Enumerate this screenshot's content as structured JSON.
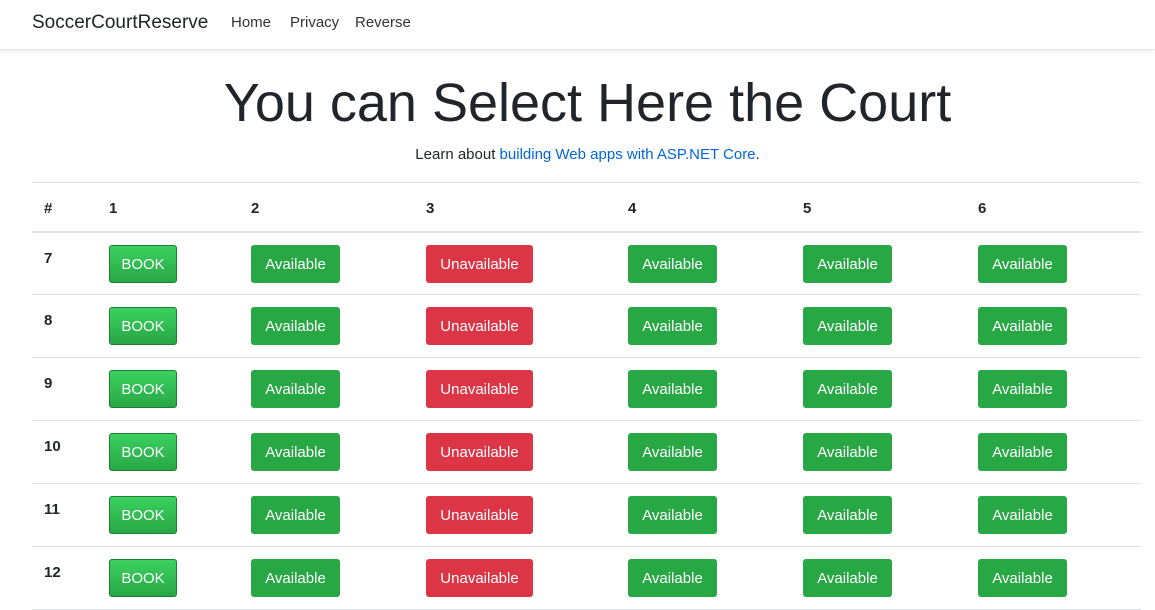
{
  "navbar": {
    "brand": "SoccerCourtReserve",
    "links": [
      "Home",
      "Privacy",
      "Reverse"
    ]
  },
  "hero": {
    "title": "You can Select Here the Court",
    "sub_prefix": "Learn about ",
    "sub_link": "building Web apps with ASP.NET Core",
    "sub_suffix": "."
  },
  "table": {
    "headers": [
      "#",
      "1",
      "2",
      "3",
      "4",
      "5",
      "6"
    ],
    "rows": [
      {
        "num": "7",
        "cells": [
          "BOOK",
          "Available",
          "Unavailable",
          "Available",
          "Available",
          "Available"
        ]
      },
      {
        "num": "8",
        "cells": [
          "BOOK",
          "Available",
          "Unavailable",
          "Available",
          "Available",
          "Available"
        ]
      },
      {
        "num": "9",
        "cells": [
          "BOOK",
          "Available",
          "Unavailable",
          "Available",
          "Available",
          "Available"
        ]
      },
      {
        "num": "10",
        "cells": [
          "BOOK",
          "Available",
          "Unavailable",
          "Available",
          "Available",
          "Available"
        ]
      },
      {
        "num": "11",
        "cells": [
          "BOOK",
          "Available",
          "Unavailable",
          "Available",
          "Available",
          "Available"
        ]
      },
      {
        "num": "12",
        "cells": [
          "BOOK",
          "Available",
          "Unavailable",
          "Available",
          "Available",
          "Available"
        ]
      }
    ]
  },
  "colors": {
    "book": "#34c759",
    "available": "#28a745",
    "unavailable": "#dc3545",
    "link": "#0366d6"
  }
}
